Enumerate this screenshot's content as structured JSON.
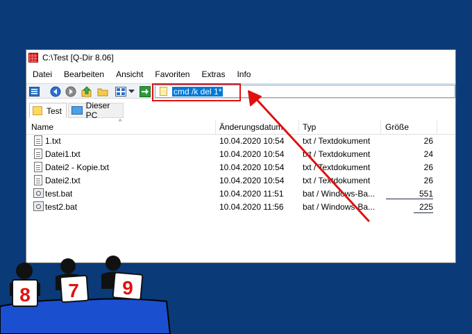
{
  "window": {
    "title": "C:\\Test  [Q-Dir 8.06]"
  },
  "menu": {
    "items": [
      "Datei",
      "Bearbeiten",
      "Ansicht",
      "Favoriten",
      "Extras",
      "Info"
    ]
  },
  "address": {
    "value": "cmd /k del 1*"
  },
  "tabs": [
    {
      "label": "Test",
      "active": true
    },
    {
      "label": "Dieser PC",
      "active": false
    }
  ],
  "columns": [
    "Name",
    "Änderungsdatum",
    "Typ",
    "Größe"
  ],
  "files": [
    {
      "name": "1.txt",
      "date": "10.04.2020 10:54",
      "type": "txt / Textdokument",
      "size": "26",
      "kind": "txt"
    },
    {
      "name": "Datei1.txt",
      "date": "10.04.2020 10:54",
      "type": "txt / Textdokument",
      "size": "24",
      "kind": "txt"
    },
    {
      "name": "Datei2 - Kopie.txt",
      "date": "10.04.2020 10:54",
      "type": "txt / Textdokument",
      "size": "26",
      "kind": "txt"
    },
    {
      "name": "Datei2.txt",
      "date": "10.04.2020 10:54",
      "type": "txt / Textdokument",
      "size": "26",
      "kind": "txt"
    },
    {
      "name": "test.bat",
      "date": "10.04.2020 11:51",
      "type": "bat / Windows-Ba...",
      "size": "551",
      "kind": "bat"
    },
    {
      "name": "test2.bat",
      "date": "10.04.2020 11:56",
      "type": "bat / Windows-Ba...",
      "size": "225",
      "kind": "bat"
    }
  ],
  "jury": {
    "scores": [
      "8",
      "7",
      "9"
    ]
  },
  "colors": {
    "desktop": "#0a3a78",
    "accent": "#0078d7",
    "annotation": "#e01010"
  }
}
